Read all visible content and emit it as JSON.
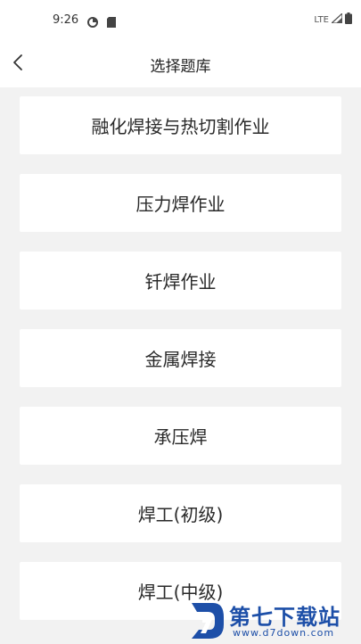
{
  "status_bar": {
    "time": "9:26",
    "network": "LTE",
    "icons": [
      "data-saver-icon",
      "sim-card-icon",
      "signal-icon",
      "battery-icon"
    ]
  },
  "header": {
    "title": "选择题库",
    "back_icon": "chevron-left-icon"
  },
  "question_banks": [
    {
      "label": "融化焊接与热切割作业"
    },
    {
      "label": "压力焊作业"
    },
    {
      "label": "钎焊作业"
    },
    {
      "label": "金属焊接"
    },
    {
      "label": "承压焊"
    },
    {
      "label": "焊工(初级)"
    },
    {
      "label": "焊工(中级)"
    }
  ],
  "watermark": {
    "title": "第七下载站",
    "url": "www.d7down.com",
    "logo_icon": "d7-logo-icon"
  },
  "colors": {
    "background": "#f2f2f2",
    "card": "#ffffff",
    "text": "#222222",
    "watermark_blue": "#1d4fa8"
  }
}
